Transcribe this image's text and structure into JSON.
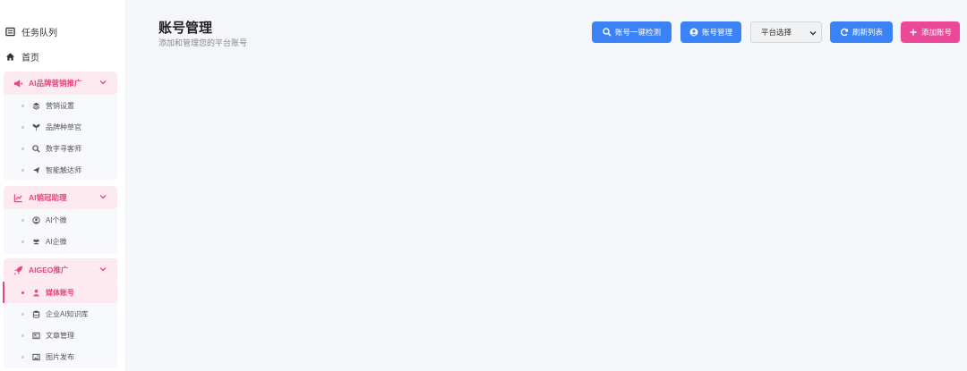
{
  "sidebar": {
    "top_items": [
      {
        "label": "任务队列",
        "icon": "list-icon"
      },
      {
        "label": "首页",
        "icon": "home-icon"
      }
    ],
    "groups": [
      {
        "title": "AI品牌营销推广",
        "icon": "megaphone-icon",
        "items": [
          {
            "label": "营销设置",
            "icon": "layers-icon"
          },
          {
            "label": "品牌种草官",
            "icon": "seedling-icon"
          },
          {
            "label": "数字寻客师",
            "icon": "search-icon"
          },
          {
            "label": "智能触达师",
            "icon": "send-icon"
          }
        ]
      },
      {
        "title": "AI销冠助理",
        "icon": "chart-line-icon",
        "items": [
          {
            "label": "AI个微",
            "icon": "user-circle-icon"
          },
          {
            "label": "AI企微",
            "icon": "users-icon"
          }
        ]
      },
      {
        "title": "AIGEO推广",
        "icon": "rocket-icon",
        "items": [
          {
            "label": "媒体账号",
            "icon": "user-icon",
            "active": true
          },
          {
            "label": "企业AI知识库",
            "icon": "database-icon"
          },
          {
            "label": "文章管理",
            "icon": "newspaper-icon"
          },
          {
            "label": "图片发布",
            "icon": "image-icon"
          }
        ]
      }
    ]
  },
  "header": {
    "title": "账号管理",
    "subtitle": "添加和管理您的平台账号"
  },
  "toolbar": {
    "check_label": "账号一键检测",
    "manage_label": "账号管理",
    "platform_select": "平台选择",
    "refresh_label": "刷新列表",
    "add_label": "添加账号"
  },
  "colors": {
    "accent_pink": "#e8447f",
    "primary_blue": "#3b82f6",
    "add_button": "#ec4899"
  }
}
